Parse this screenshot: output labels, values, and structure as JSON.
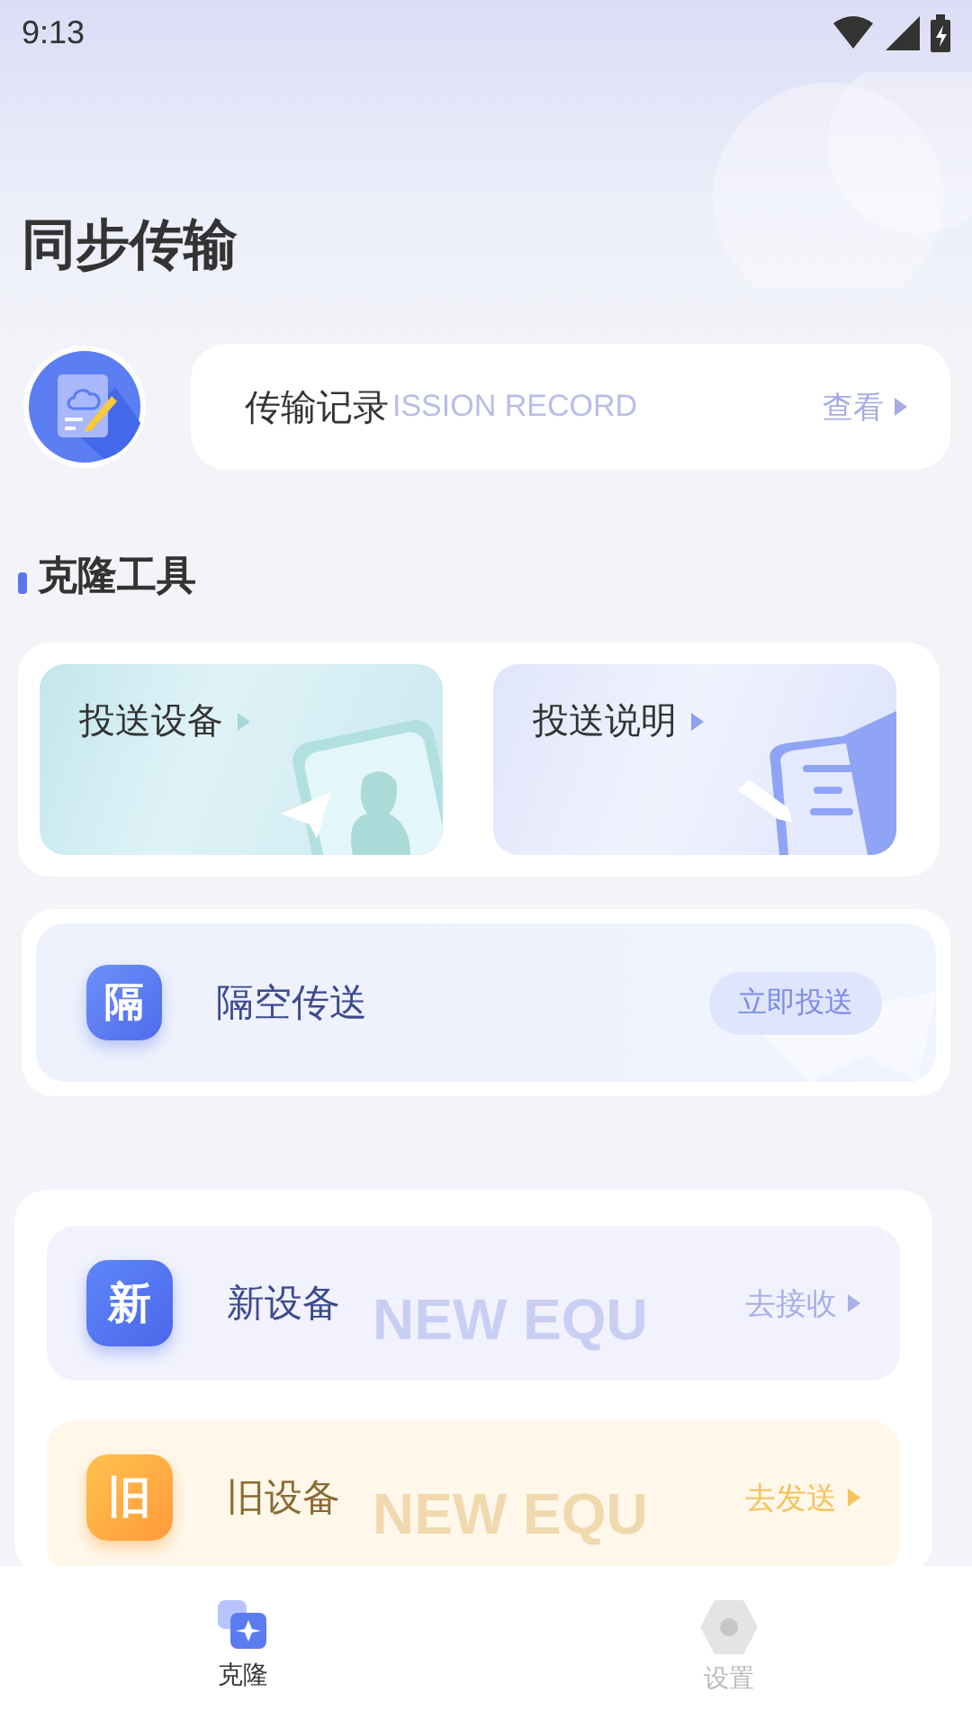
{
  "status_bar": {
    "time": "9:13"
  },
  "page_title": "同步传输",
  "record": {
    "title": "传输记录",
    "ghost": "ISSION RECORD",
    "action": "查看"
  },
  "section_title": "克隆工具",
  "cast_cards": [
    {
      "title": "投送设备",
      "kind": "device"
    },
    {
      "title": "投送说明",
      "kind": "guide"
    }
  ],
  "air_transfer": {
    "badge": "隔",
    "title": "隔空传送",
    "action": "立即投送"
  },
  "devices": [
    {
      "badge": "新",
      "title": "新设备",
      "action": "去接收",
      "ghost": "NEW EQU",
      "kind": "new"
    },
    {
      "badge": "旧",
      "title": "旧设备",
      "action": "去发送",
      "ghost": "NEW EQU",
      "kind": "old"
    }
  ],
  "tabs": [
    {
      "label": "克隆",
      "selected": true,
      "kind": "clone"
    },
    {
      "label": "设置",
      "selected": false,
      "kind": "settings"
    }
  ]
}
